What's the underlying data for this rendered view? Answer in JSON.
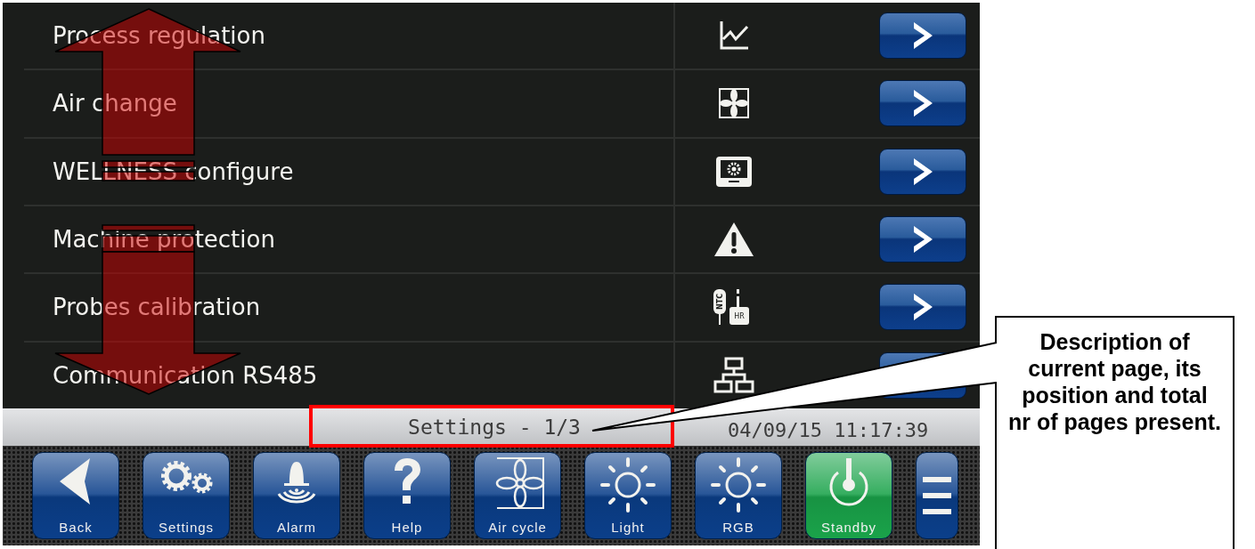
{
  "menu_rows": [
    {
      "label": "Process regulation",
      "kind": "chart"
    },
    {
      "label": "Air change",
      "kind": "fan"
    },
    {
      "label": "WELLNESS configure",
      "kind": "display"
    },
    {
      "label": "Machine protection",
      "kind": "warning"
    },
    {
      "label": "Probes calibration",
      "kind": "probes",
      "icon_labels": [
        "NTC",
        "HR"
      ]
    },
    {
      "label": "Communication RS485",
      "kind": "network"
    }
  ],
  "status_bar": {
    "page_title": "Settings - 1/3",
    "datetime": "04/09/15 11:17:39"
  },
  "toolbar": [
    {
      "label": "Back",
      "kind": "back",
      "color": "#0b3f8a"
    },
    {
      "label": "Settings",
      "kind": "gears",
      "color": "#0b3f8a"
    },
    {
      "label": "Alarm",
      "kind": "bell",
      "color": "#0b3f8a"
    },
    {
      "label": "Help",
      "kind": "help",
      "color": "#0b3f8a"
    },
    {
      "label": "Air cycle",
      "kind": "fan",
      "color": "#0b3f8a"
    },
    {
      "label": "Light",
      "kind": "sun",
      "color": "#0b3f8a"
    },
    {
      "label": "RGB",
      "kind": "sun",
      "color": "#0b3f8a"
    },
    {
      "label": "Standby",
      "kind": "power",
      "color": "#1aa34a"
    },
    {
      "kind": "menu",
      "color": "#0b3f8a"
    }
  ],
  "annotation": {
    "callout": "Description of current page, its position and total nr of pages present."
  }
}
